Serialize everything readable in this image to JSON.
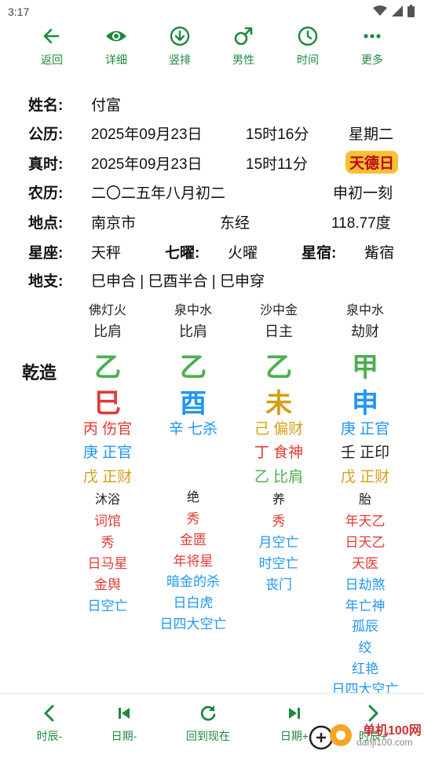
{
  "status": {
    "time": "3:17"
  },
  "toolbar": [
    {
      "label": "返回"
    },
    {
      "label": "详细"
    },
    {
      "label": "竖排"
    },
    {
      "label": "男性"
    },
    {
      "label": "时间"
    },
    {
      "label": "更多"
    }
  ],
  "info": {
    "name_label": "姓名:",
    "name_value": "付富",
    "solar_label": "公历:",
    "solar_date": "2025年09月23日",
    "solar_time": "15时16分",
    "weekday": "星期二",
    "true_label": "真时:",
    "true_date": "2025年09月23日",
    "true_time": "15时11分",
    "badge": "天德日",
    "lunar_label": "农历:",
    "lunar_date": "二〇二五年八月初二",
    "lunar_time": "申初一刻",
    "place_label": "地点:",
    "place_city": "南京市",
    "place_lng_label": "东经",
    "place_lng": "118.77度",
    "star_label": "星座:",
    "star_value": "天秤",
    "qiyao_label": "七曜:",
    "qiyao_value": "火曜",
    "xiu_label": "星宿:",
    "xiu_value": "觜宿",
    "dizhi_label": "地支:",
    "dizhi_value": "巳申合 | 巳酉半合 | 巳申穿"
  },
  "chart": {
    "title": "乾造",
    "columns": [
      {
        "nayin": "佛灯火",
        "shishen": "比肩",
        "gan": "乙",
        "zhi": "巳",
        "canggan": [
          {
            "gan": "丙",
            "shen": "伤官"
          },
          {
            "gan": "庚",
            "shen": "正官"
          },
          {
            "gan": "戊",
            "shen": "正财"
          }
        ],
        "state": "沐浴",
        "shensha": [
          "词馆",
          "秀",
          "日马星",
          "金舆",
          "日空亡"
        ]
      },
      {
        "nayin": "泉中水",
        "shishen": "比肩",
        "gan": "乙",
        "zhi": "酉",
        "canggan": [
          {
            "gan": "辛",
            "shen": "七杀"
          }
        ],
        "state": "绝",
        "shensha": [
          "秀",
          "金匮",
          "年将星",
          "暗金的杀",
          "日白虎",
          "日四大空亡"
        ]
      },
      {
        "nayin": "沙中金",
        "shishen": "日主",
        "gan": "乙",
        "zhi": "未",
        "canggan": [
          {
            "gan": "己",
            "shen": "偏财"
          },
          {
            "gan": "丁",
            "shen": "食神"
          },
          {
            "gan": "乙",
            "shen": "比肩"
          }
        ],
        "state": "养",
        "shensha": [
          "秀",
          "月空亡",
          "时空亡",
          "丧门"
        ]
      },
      {
        "nayin": "泉中水",
        "shishen": "劫财",
        "gan": "甲",
        "zhi": "申",
        "canggan": [
          {
            "gan": "庚",
            "shen": "正官"
          },
          {
            "gan": "壬",
            "shen": "正印"
          },
          {
            "gan": "戊",
            "shen": "正财"
          }
        ],
        "state": "胎",
        "shensha": [
          "年天乙",
          "日天乙",
          "天医",
          "日劫煞",
          "年亡神",
          "孤辰",
          "绞",
          "红艳",
          "日四大空亡"
        ]
      }
    ]
  },
  "bottom": [
    {
      "label": "时辰-"
    },
    {
      "label": "日期-"
    },
    {
      "label": "回到现在"
    },
    {
      "label": "日期+"
    },
    {
      "label": "时辰+"
    }
  ],
  "watermark": {
    "text": "单机100网",
    "sub": "danji100.com"
  },
  "colors": {
    "accent": "#1d8a3e",
    "wood": "#4caf50",
    "fire": "#e53935",
    "water": "#2196f3",
    "earth": "#d4a017",
    "badge_bg": "#f6c132"
  }
}
